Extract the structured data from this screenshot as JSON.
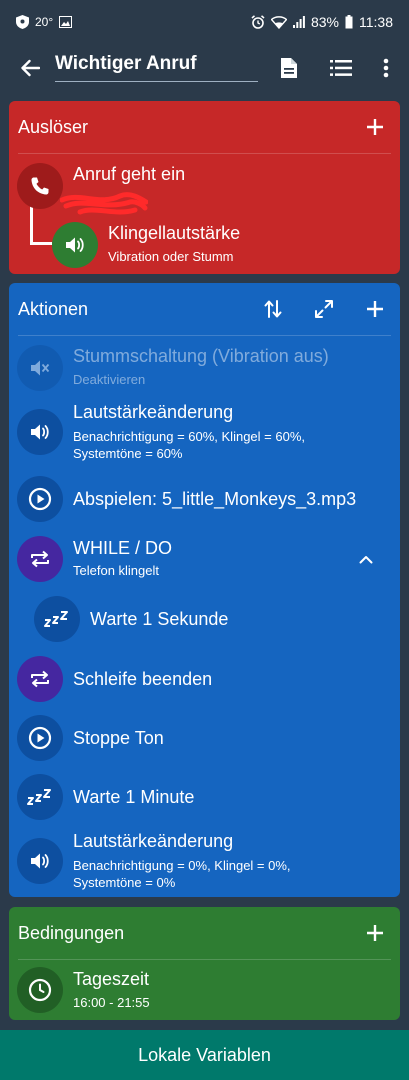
{
  "status_bar": {
    "temperature": "20°",
    "battery": "83%",
    "time": "11:38",
    "icons": [
      "shield-icon",
      "image-icon",
      "alarm-icon",
      "wifi-icon",
      "signal-icon",
      "battery-icon"
    ]
  },
  "app_bar": {
    "title": "Wichtiger Anruf",
    "icons": [
      "back-arrow-icon",
      "document-icon",
      "list-icon",
      "more-vert-icon"
    ]
  },
  "triggers": {
    "header": "Auslöser",
    "color": "#c62828",
    "items": [
      {
        "title": "Anruf geht ein",
        "icon": "phone-icon"
      },
      {
        "title": "Klingellautstärke",
        "subtitle": "Vibration oder Stumm",
        "icon": "volume-icon"
      }
    ]
  },
  "actions": {
    "header": "Aktionen",
    "color": "#1565c0",
    "items": [
      {
        "title": "Stummschaltung (Vibration aus)",
        "subtitle": "Deaktivieren",
        "icon": "volume-off-icon",
        "disabled": true
      },
      {
        "title": "Lautstärkeänderung",
        "subtitle_lines": [
          "Benachrichtigung = 60%, Klingel = 60%,",
          "Systemtöne = 60%"
        ],
        "icon": "volume-icon"
      },
      {
        "title": "Abspielen: 5_little_Monkeys_3.mp3",
        "icon": "play-icon"
      },
      {
        "title": "WHILE / DO",
        "subtitle": "Telefon klingelt",
        "icon": "repeat-icon"
      },
      {
        "title": "Warte 1 Sekunde",
        "icon": "zzz-icon"
      },
      {
        "title": "Schleife beenden",
        "icon": "repeat-icon"
      },
      {
        "title": "Stoppe Ton",
        "icon": "play-icon"
      },
      {
        "title": "Warte 1 Minute",
        "icon": "zzz-icon"
      },
      {
        "title": "Lautstärkeänderung",
        "subtitle_lines": [
          "Benachrichtigung = 0%, Klingel = 0%,",
          "Systemtöne = 0%"
        ],
        "icon": "volume-icon"
      }
    ]
  },
  "constraints": {
    "header": "Bedingungen",
    "color": "#2e7d32",
    "items": [
      {
        "title": "Tageszeit",
        "subtitle": "16:00 - 21:55",
        "icon": "clock-icon"
      }
    ]
  },
  "bottom_bar": {
    "label": "Lokale Variablen",
    "color": "#00796b"
  }
}
